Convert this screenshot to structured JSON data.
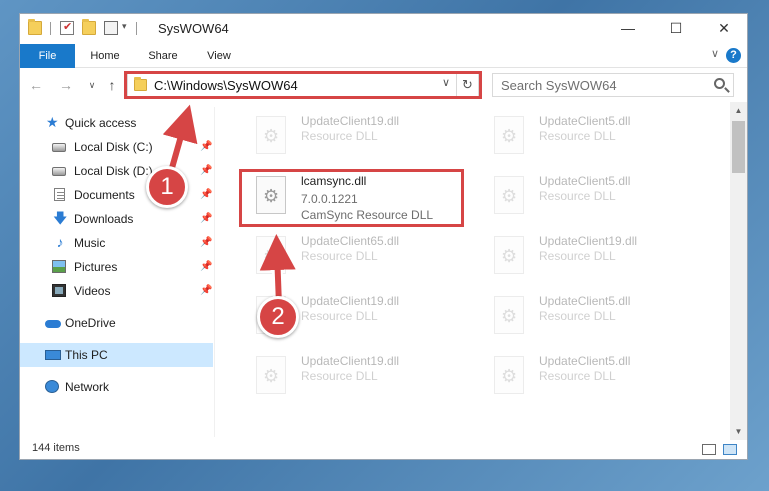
{
  "window": {
    "title": "SysWOW64",
    "minimize": "—",
    "maximize": "☐",
    "close": "✕"
  },
  "ribbon": {
    "tabs": [
      "File",
      "Home",
      "Share",
      "View"
    ],
    "expand_glyph": "∨",
    "help_glyph": "?"
  },
  "nav": {
    "back_glyph": "←",
    "forward_glyph": "→",
    "recent_glyph": "∨",
    "up_glyph": "↑",
    "address": "C:\\Windows\\SysWOW64",
    "address_drop": "∨",
    "refresh_glyph": "↻",
    "search_placeholder": "Search SysWOW64"
  },
  "sidebar": {
    "pin_glyph": "📌",
    "items": [
      {
        "label": "Quick access",
        "icon": "star-icon"
      },
      {
        "label": "Local Disk (C:)",
        "icon": "disk-icon"
      },
      {
        "label": "Local Disk (D:)",
        "icon": "disk-icon"
      },
      {
        "label": "Documents",
        "icon": "documents-icon"
      },
      {
        "label": "Downloads",
        "icon": "download-icon"
      },
      {
        "label": "Music",
        "icon": "music-icon"
      },
      {
        "label": "Pictures",
        "icon": "pictures-icon"
      },
      {
        "label": "Videos",
        "icon": "videos-icon"
      },
      {
        "label": "OneDrive",
        "icon": "cloud-icon"
      },
      {
        "label": "This PC",
        "icon": "computer-icon"
      },
      {
        "label": "Network",
        "icon": "network-icon"
      }
    ]
  },
  "highlighted_file": {
    "name": "lcamsync.dll",
    "version": "7.0.0.1221",
    "description": "CamSync Resource DLL"
  },
  "background_files": [
    {
      "name": "UpdateClient19.dll",
      "type": "Resource DLL"
    },
    {
      "name": "UpdateClient5.dll",
      "type": "Resource DLL"
    },
    {
      "name": "UpdateClient5.dll",
      "type": "Resource DLL"
    },
    {
      "name": "UpdateClient65.dll",
      "type": "Resource DLL"
    },
    {
      "name": "UpdateClient19.dll",
      "type": "Resource DLL"
    },
    {
      "name": "UpdateClient19.dll",
      "type": "Resource DLL"
    },
    {
      "name": "UpdateClient5.dll",
      "type": "Resource DLL"
    },
    {
      "name": "UpdateClient19.dll",
      "type": "Resource DLL"
    },
    {
      "name": "UpdateClient5.dll",
      "type": "Resource DLL"
    }
  ],
  "status": {
    "count": "144 items"
  },
  "callouts": [
    "1",
    "2"
  ],
  "colors": {
    "accent": "#1979ca",
    "highlight_box": "#d64545",
    "selection": "#cce8ff"
  }
}
